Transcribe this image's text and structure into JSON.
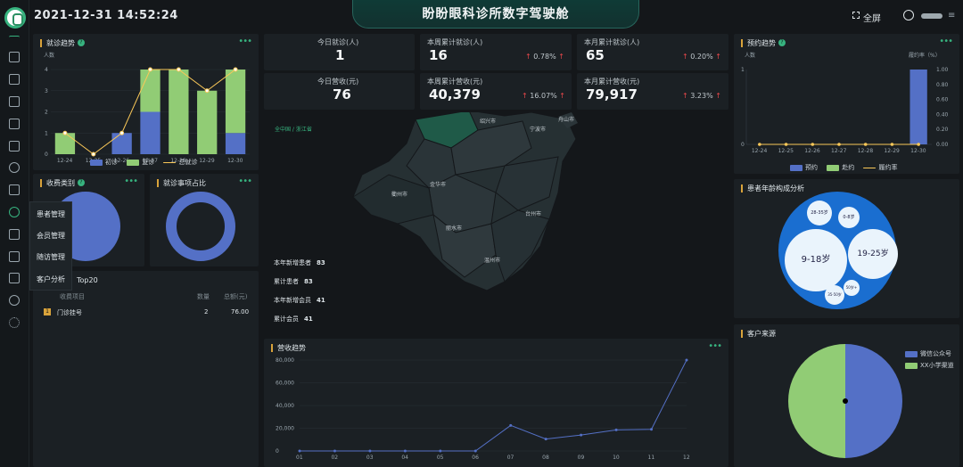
{
  "app": {
    "datetime": "2021-12-31 14:52:24",
    "title": "盼盼眼科诊所数字驾驶舱",
    "fullscreen": "全屏"
  },
  "sidebar": {
    "items": [
      "menu-icon",
      "monitor-icon",
      "home-icon",
      "bag-icon",
      "calendar-icon",
      "document-icon",
      "eye-icon",
      "card-icon",
      "user-icon",
      "crown-icon",
      "cart-icon",
      "house-icon",
      "chart-icon",
      "settings-icon"
    ],
    "submenu": [
      "患者管理",
      "会员管理",
      "随访管理",
      "客户分析"
    ]
  },
  "visits_trend": {
    "title": "就诊趋势",
    "y_unit": "人数",
    "legend": [
      "初诊",
      "复诊",
      "总就诊"
    ],
    "more": "•••"
  },
  "stats": [
    {
      "label": "今日就诊(人)",
      "value": "1"
    },
    {
      "label": "本周累计就诊(人)",
      "value": "16",
      "pct": "0.78%"
    },
    {
      "label": "本月累计就诊(人)",
      "value": "65",
      "pct": "0.20%"
    },
    {
      "label": "今日营收(元)",
      "value": "76"
    },
    {
      "label": "本周累计营收(元)",
      "value": "40,379",
      "pct": "16.07%"
    },
    {
      "label": "本月累计营收(元)",
      "value": "79,917",
      "pct": "3.23%"
    }
  ],
  "map": {
    "breadcrumb": "全中国 / 浙江省",
    "cities": [
      "绍兴市",
      "宁波市",
      "舟山市",
      "衢州市",
      "金华市",
      "丽水市",
      "台州市",
      "温州市"
    ],
    "stats": [
      {
        "label": "本年新增患者",
        "value": "83"
      },
      {
        "label": "累计患者",
        "value": "83"
      },
      {
        "label": "本年新增会员",
        "value": "41"
      },
      {
        "label": "累计会员",
        "value": "41"
      }
    ]
  },
  "appointment_trend": {
    "title": "预约趋势",
    "y_left_unit": "人数",
    "y_right_unit": "履约率（%）",
    "legend": [
      "预约",
      "赴约",
      "履约率"
    ]
  },
  "fee_category": {
    "title": "收费类别"
  },
  "visit_items": {
    "title": "就诊事项占比"
  },
  "top20": {
    "title": "Top20",
    "columns": [
      "收费项目",
      "数量",
      "总额(元)"
    ],
    "rows": [
      {
        "rank": "1",
        "name": "门诊挂号",
        "qty": "2",
        "amount": "76.00"
      }
    ]
  },
  "age_analysis": {
    "title": "患者年龄构成分析",
    "bubbles": [
      "28-35岁",
      "0-8岁",
      "9-18岁",
      "19-25岁",
      "50岁+",
      "35-50岁"
    ]
  },
  "revenue_trend": {
    "title": "营收趋势"
  },
  "customer_source": {
    "title": "客户来源",
    "legend": [
      "微信公众号",
      "XX小学渠道"
    ]
  },
  "chart_data": [
    {
      "type": "bar",
      "title": "就诊趋势",
      "categories": [
        "12-24",
        "12-25",
        "12-26",
        "12-27",
        "12-28",
        "12-29",
        "12-30"
      ],
      "series": [
        {
          "name": "初诊",
          "values": [
            0,
            0,
            1,
            2,
            0,
            0,
            1
          ]
        },
        {
          "name": "复诊",
          "values": [
            1,
            0,
            0,
            2,
            4,
            3,
            3
          ]
        },
        {
          "name": "总就诊",
          "values": [
            1,
            0,
            1,
            4,
            4,
            3,
            4
          ]
        }
      ],
      "ylabel": "人数",
      "ylim": [
        0,
        4
      ],
      "colors": [
        "#5470c6",
        "#91cc75",
        "#fac858"
      ]
    },
    {
      "type": "bar",
      "title": "预约趋势",
      "categories": [
        "12-24",
        "12-25",
        "12-26",
        "12-27",
        "12-28",
        "12-29",
        "12-30"
      ],
      "series": [
        {
          "name": "预约",
          "values": [
            0,
            0,
            0,
            0,
            0,
            0,
            1
          ]
        },
        {
          "name": "赴约",
          "values": [
            0,
            0,
            0,
            0,
            0,
            0,
            0
          ]
        },
        {
          "name": "履约率",
          "values": [
            0,
            0,
            0,
            0,
            0,
            0,
            0
          ]
        }
      ],
      "ylim": [
        0,
        1
      ],
      "y2lim": [
        0,
        100
      ]
    },
    {
      "type": "line",
      "title": "营收趋势",
      "x": [
        "01",
        "02",
        "03",
        "04",
        "05",
        "06",
        "07",
        "08",
        "09",
        "10",
        "11",
        "12"
      ],
      "values": [
        0,
        0,
        0,
        0,
        0,
        0,
        22500,
        10500,
        14000,
        18500,
        19000,
        80000
      ],
      "ylim": [
        0,
        80000
      ],
      "yticks": [
        "0",
        "20,000",
        "40,000",
        "60,000",
        "80,000"
      ]
    },
    {
      "type": "pie",
      "title": "客户来源",
      "labels": [
        "微信公众号",
        "XX小学渠道"
      ],
      "values": [
        50,
        50
      ],
      "colors": [
        "#5470c6",
        "#91cc75"
      ]
    }
  ]
}
